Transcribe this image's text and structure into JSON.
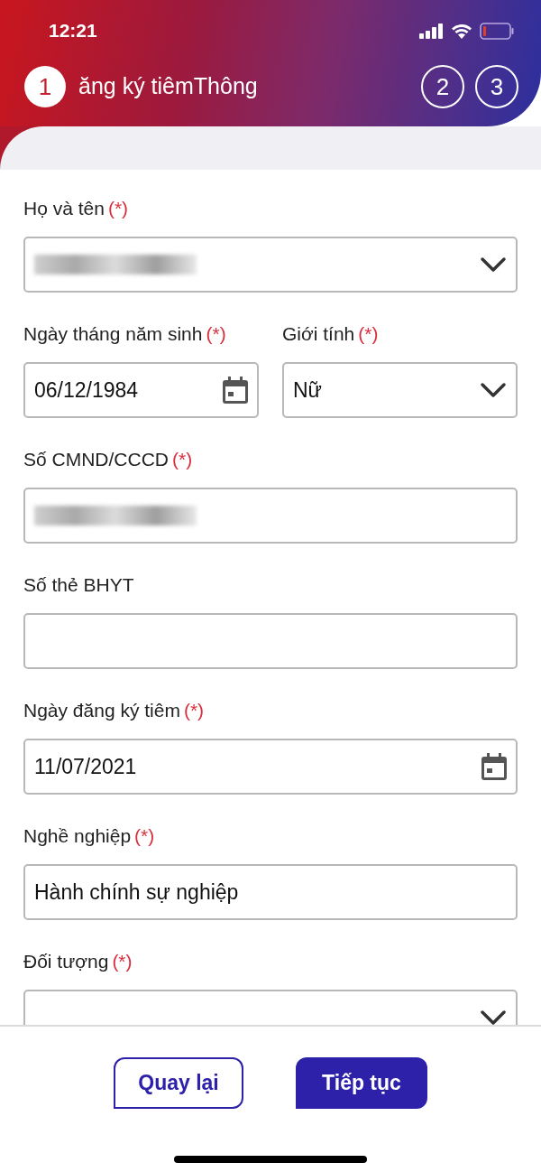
{
  "status_bar": {
    "time": "12:21"
  },
  "header": {
    "title": "ăng ký tiêmThông",
    "steps": [
      {
        "label": "1",
        "selected": true
      },
      {
        "label": "2",
        "selected": false
      },
      {
        "label": "3",
        "selected": false
      }
    ]
  },
  "form": {
    "rows": [
      {
        "fields": [
          {
            "kind": "select",
            "label": "Họ và tên",
            "required_mark": "(*)",
            "value_blurred": true
          }
        ]
      },
      {
        "fields": [
          {
            "kind": "date",
            "label": "Ngày tháng năm sinh",
            "required_mark": "(*)",
            "value": "06/12/1984"
          },
          {
            "kind": "select",
            "label": "Giới tính",
            "required_mark": "(*)",
            "value": "Nữ"
          }
        ]
      },
      {
        "fields": [
          {
            "kind": "text",
            "label": "Số CMND/CCCD",
            "required_mark": "(*)",
            "value_blurred": true
          }
        ]
      },
      {
        "fields": [
          {
            "kind": "text",
            "label": "Số thẻ BHYT"
          }
        ]
      },
      {
        "fields": [
          {
            "kind": "date",
            "label": "Ngày đăng ký tiêm",
            "required_mark": "(*)",
            "value": "11/07/2021"
          }
        ]
      },
      {
        "fields": [
          {
            "kind": "text",
            "label": "Nghề nghiệp",
            "required_mark": "(*)",
            "value": "Hành chính sự nghiệp"
          }
        ]
      },
      {
        "fields": [
          {
            "kind": "select",
            "label": "Đối tượng",
            "required_mark": "(*)"
          }
        ]
      }
    ]
  },
  "buttons": [
    {
      "kind": "outline",
      "label": "Quay lại"
    },
    {
      "kind": "filled",
      "label": "Tiếp tục"
    }
  ]
}
